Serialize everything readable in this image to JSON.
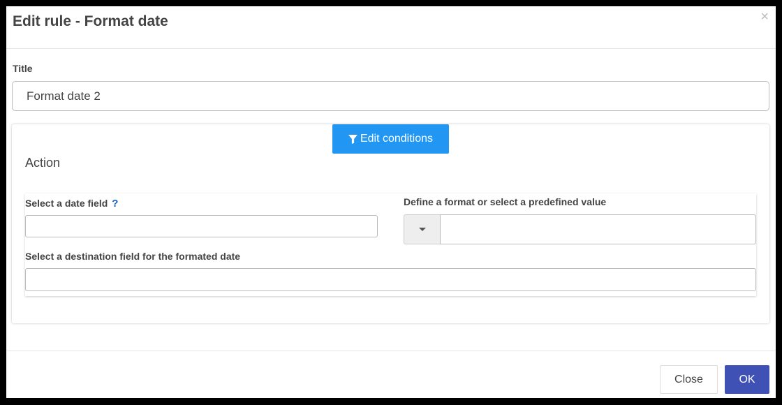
{
  "dialog": {
    "title": "Edit rule - Format date",
    "close_symbol": "×"
  },
  "form": {
    "title_label": "Title",
    "title_value": "Format date 2"
  },
  "panel": {
    "edit_conditions_label": "Edit conditions",
    "filter_icon": "filter-icon",
    "action_label": "Action",
    "date_field_label": "Select a date field",
    "help_symbol": "?",
    "format_label": "Define a format or select a predefined value",
    "destination_label": "Select a destination field for the formated date"
  },
  "footer": {
    "close_label": "Close",
    "ok_label": "OK"
  },
  "colors": {
    "primary_button": "#2196f3",
    "ok_button": "#3f51b5",
    "help_icon": "#1565c0"
  }
}
